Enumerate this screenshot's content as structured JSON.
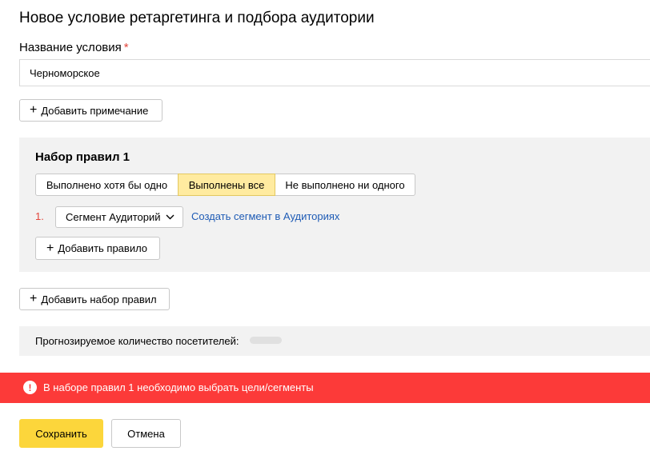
{
  "page": {
    "title": "Новое условие ретаргетинга и подбора аудитории"
  },
  "name_field": {
    "label": "Название условия",
    "required_mark": "*",
    "value": "Черноморское"
  },
  "add_note_button": {
    "icon": "plus-icon",
    "label": "Добавить примечание"
  },
  "ruleset": {
    "title": "Набор правил 1",
    "conditions": [
      {
        "label": "Выполнено хотя бы одно",
        "selected": false
      },
      {
        "label": "Выполнены все",
        "selected": true
      },
      {
        "label": "Не выполнено ни одного",
        "selected": false
      }
    ],
    "rules": [
      {
        "number": "1.",
        "type_select": "Сегмент Аудиторий",
        "create_link": "Создать сегмент в Аудиториях"
      }
    ],
    "add_rule_button": {
      "icon": "plus-icon",
      "label": "Добавить правило"
    }
  },
  "add_ruleset_button": {
    "icon": "plus-icon",
    "label": "Добавить набор правил"
  },
  "forecast": {
    "label": "Прогнозируемое количество посетителей:"
  },
  "error": {
    "icon": "exclamation-icon",
    "text": "В наборе правил 1 необходимо выбрать цели/сегменты"
  },
  "footer": {
    "save_label": "Сохранить",
    "cancel_label": "Отмена"
  },
  "colors": {
    "selected_segment": "#ffeba0",
    "save_button": "#fcd63b",
    "error_bar": "#fc3a39",
    "link": "#1e5bb5",
    "required": "#e2453b"
  }
}
